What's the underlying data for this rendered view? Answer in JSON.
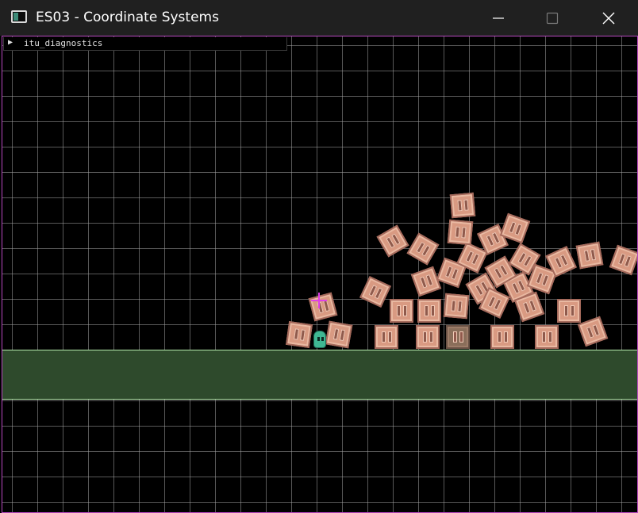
{
  "window": {
    "title": "ES03 - Coordinate Systems",
    "icon": "app-window-icon",
    "controls": [
      "minimize-icon",
      "maximize-icon",
      "close-icon"
    ]
  },
  "diagnostics": {
    "label": "itu_diagnostics",
    "toggle_icon": "triangle-right-icon",
    "expanded": false
  },
  "scene": {
    "background": "#000000",
    "grid_color": "#a0a0a0",
    "ground_color": "#2e4a2c",
    "ground_outline": "#b9f0b0",
    "border_color": "#b848c0",
    "crate_color": "#d99a82",
    "player_color": "#3fb893",
    "cursor_color": "#e040e8",
    "crate_count": 37
  }
}
